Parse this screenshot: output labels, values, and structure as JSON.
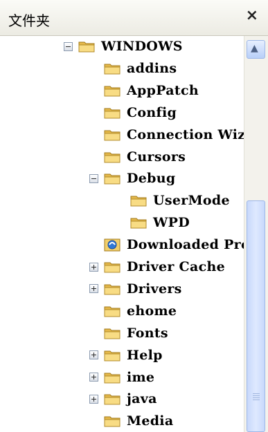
{
  "panel": {
    "title": "文件夹",
    "close_glyph": "×"
  },
  "tree": {
    "items": [
      {
        "label": "WINDOWS",
        "level": 0,
        "expander": "minus",
        "icon": "folder-icon"
      },
      {
        "label": "addins",
        "level": 1,
        "expander": "none",
        "icon": "folder-icon"
      },
      {
        "label": "AppPatch",
        "level": 1,
        "expander": "none",
        "icon": "folder-icon"
      },
      {
        "label": "Config",
        "level": 1,
        "expander": "none",
        "icon": "folder-icon"
      },
      {
        "label": "Connection Wiz",
        "level": 1,
        "expander": "none",
        "icon": "folder-icon"
      },
      {
        "label": "Cursors",
        "level": 1,
        "expander": "none",
        "icon": "folder-icon"
      },
      {
        "label": "Debug",
        "level": 1,
        "expander": "minus",
        "icon": "folder-icon"
      },
      {
        "label": "UserMode",
        "level": 2,
        "expander": "none",
        "icon": "folder-icon"
      },
      {
        "label": "WPD",
        "level": 2,
        "expander": "none",
        "icon": "folder-icon"
      },
      {
        "label": "Downloaded Pro",
        "level": 1,
        "expander": "none",
        "icon": "downloaded-program-files-icon"
      },
      {
        "label": "Driver Cache",
        "level": 1,
        "expander": "plus",
        "icon": "folder-icon"
      },
      {
        "label": "Drivers",
        "level": 1,
        "expander": "plus",
        "icon": "folder-icon"
      },
      {
        "label": "ehome",
        "level": 1,
        "expander": "none",
        "icon": "folder-icon"
      },
      {
        "label": "Fonts",
        "level": 1,
        "expander": "none",
        "icon": "folder-icon"
      },
      {
        "label": "Help",
        "level": 1,
        "expander": "plus",
        "icon": "folder-icon"
      },
      {
        "label": "ime",
        "level": 1,
        "expander": "plus",
        "icon": "folder-icon"
      },
      {
        "label": "java",
        "level": 1,
        "expander": "plus",
        "icon": "folder-icon"
      },
      {
        "label": "Media",
        "level": 1,
        "expander": "none",
        "icon": "folder-icon"
      }
    ]
  },
  "scrollbar": {
    "up_arrow_glyph": "▲",
    "position": 0.45
  }
}
